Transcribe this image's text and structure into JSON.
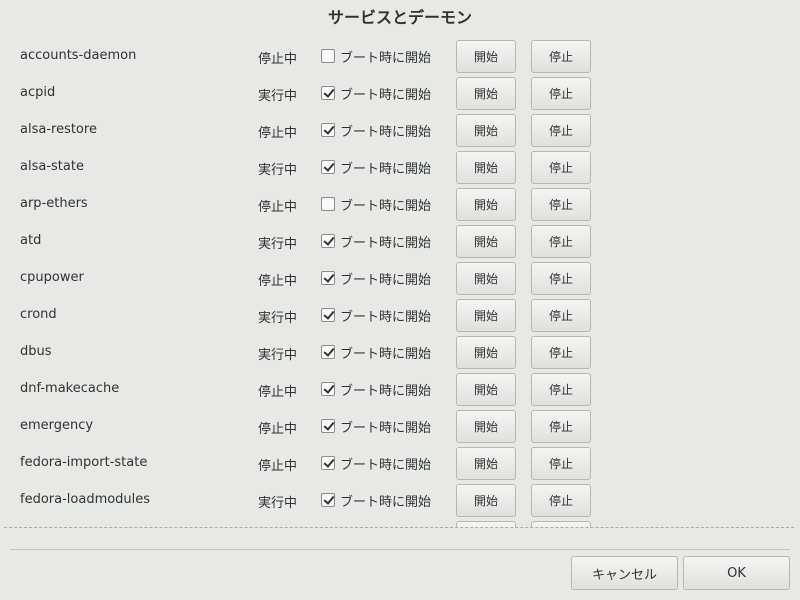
{
  "title": "サービスとデーモン",
  "boot_label": "ブート時に開始",
  "start_label": "開始",
  "stop_label": "停止",
  "services": [
    {
      "name": "accounts-daemon",
      "state": "停止中",
      "boot": false
    },
    {
      "name": "acpid",
      "state": "実行中",
      "boot": true
    },
    {
      "name": "alsa-restore",
      "state": "停止中",
      "boot": true
    },
    {
      "name": "alsa-state",
      "state": "実行中",
      "boot": true
    },
    {
      "name": "arp-ethers",
      "state": "停止中",
      "boot": false
    },
    {
      "name": "atd",
      "state": "実行中",
      "boot": true
    },
    {
      "name": "cpupower",
      "state": "停止中",
      "boot": true
    },
    {
      "name": "crond",
      "state": "実行中",
      "boot": true
    },
    {
      "name": "dbus",
      "state": "実行中",
      "boot": true
    },
    {
      "name": "dnf-makecache",
      "state": "停止中",
      "boot": true
    },
    {
      "name": "emergency",
      "state": "停止中",
      "boot": true
    },
    {
      "name": "fedora-import-state",
      "state": "停止中",
      "boot": true
    },
    {
      "name": "fedora-loadmodules",
      "state": "実行中",
      "boot": true
    },
    {
      "name": "",
      "state": "",
      "boot": null
    }
  ],
  "footer": {
    "cancel_label": "キャンセル",
    "ok_label": "OK"
  }
}
